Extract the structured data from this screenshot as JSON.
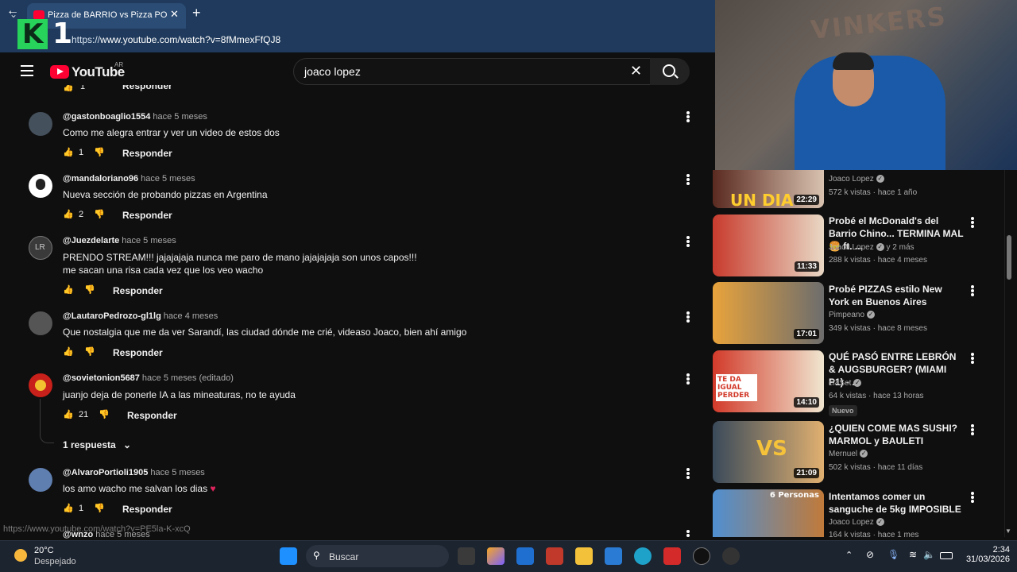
{
  "browser": {
    "tab_title": "Pizza de BARRIO vs Pizza PORTEÑA",
    "url_prefix": "https://",
    "url_main": "www.youtube.com/watch?v=8fMmexFfQJ8",
    "overlay_logo_k": "K",
    "overlay_logo_num": "1"
  },
  "youtube": {
    "logo_text": "YouTube",
    "region": "AR",
    "search_value": "joaco lopez"
  },
  "comments": {
    "top_reply_label": "Responder",
    "top_likes": "1",
    "items": [
      {
        "user": "@gastonboaglio1554",
        "time": "hace 5 meses",
        "text": "Como me alegra entrar y ver un video de estos dos",
        "likes": "1",
        "reply": "Responder"
      },
      {
        "user": "@mandaloriano96",
        "time": "hace 5 meses",
        "text": "Nueva sección de probando pizzas en Argentina",
        "likes": "2",
        "reply": "Responder"
      },
      {
        "user": "@Juezdelarte",
        "time": "hace 5 meses",
        "text": "PRENDO STREAM!!! jajajajaja nunca me paro de mano jajajajaja son unos capos!!!",
        "text2": "me sacan una risa cada vez que los veo wacho",
        "likes": "",
        "reply": "Responder"
      },
      {
        "user": "@LautaroPedrozo-gl1lg",
        "time": "hace 4 meses",
        "text": "Que nostalgia que me da ver  Sarandí, las ciudad dónde me crié, videaso Joaco, bien ahí amigo",
        "likes": "",
        "reply": "Responder"
      },
      {
        "user": "@sovietonion5687",
        "time": "hace 5 meses (editado)",
        "text": "juanjo deja de ponerle IA a las mineaturas, no te ayuda",
        "likes": "21",
        "reply": "Responder",
        "replies_label": "1 respuesta"
      },
      {
        "user": "@AlvaroPortioli1905",
        "time": "hace 5 meses",
        "text": "los amo wacho me salvan los dias",
        "likes": "1",
        "reply": "Responder"
      },
      {
        "user": "@wnzo",
        "time": "hace 5 meses"
      }
    ],
    "status_url": "https://www.youtube.com/watch?v=PE5la-K-xcQ"
  },
  "related": [
    {
      "thumb_text": "UN DIA",
      "duration": "22:29",
      "channel": "Joaco Lopez",
      "meta": "572 k vistas · hace 1 año",
      "colors": [
        "#5a2a20",
        "#d9c2b0"
      ]
    },
    {
      "title": "Probé el McDonald's del Barrio Chino... TERMINA MAL 🍔 ft. ...",
      "duration": "11:33",
      "channel": "Joaco Lopez",
      "channel_extra": "y 2 más",
      "meta": "288 k vistas · hace 4 meses",
      "colors": [
        "#c83b2d",
        "#e9d8c5"
      ]
    },
    {
      "title": "Probé PIZZAS estilo New York en Buenos Aires",
      "duration": "17:01",
      "channel": "Pimpeano",
      "meta": "349 k vistas · hace 8 meses",
      "colors": [
        "#e8a33c",
        "#6d6d6d"
      ]
    },
    {
      "title": "QUÉ PASÓ ENTRE LEBRÓN & AUGSBURGER? (MIAMI P1) - ...",
      "thumb_text": "TE DA IGUAL PERDER",
      "duration": "14:10",
      "channel": "el4Set",
      "meta": "64 k vistas · hace 13 horas",
      "badge": "Nuevo",
      "colors": [
        "#d23a2a",
        "#f0e6d0"
      ]
    },
    {
      "title": "¿QUIEN COME MAS SUSHI? MARMOL y BAULETI",
      "thumb_text": "VS",
      "duration": "21:09",
      "channel": "Mernuel",
      "meta": "502 k vistas · hace 11 días",
      "colors": [
        "#3a4a5a",
        "#e0b070"
      ]
    },
    {
      "title": "Intentamos comer un sanguche de 5kg IMPOSIBLE",
      "thumb_text": "6 Personas",
      "channel": "Joaco Lopez",
      "meta": "164 k vistas · hace 1 mes",
      "colors": [
        "#4f8fd1",
        "#c07a3a"
      ]
    }
  ],
  "taskbar": {
    "temp": "20°C",
    "weather": "Despejado",
    "search_placeholder": "Buscar",
    "time": "2:34",
    "date": "31/03/2026"
  }
}
